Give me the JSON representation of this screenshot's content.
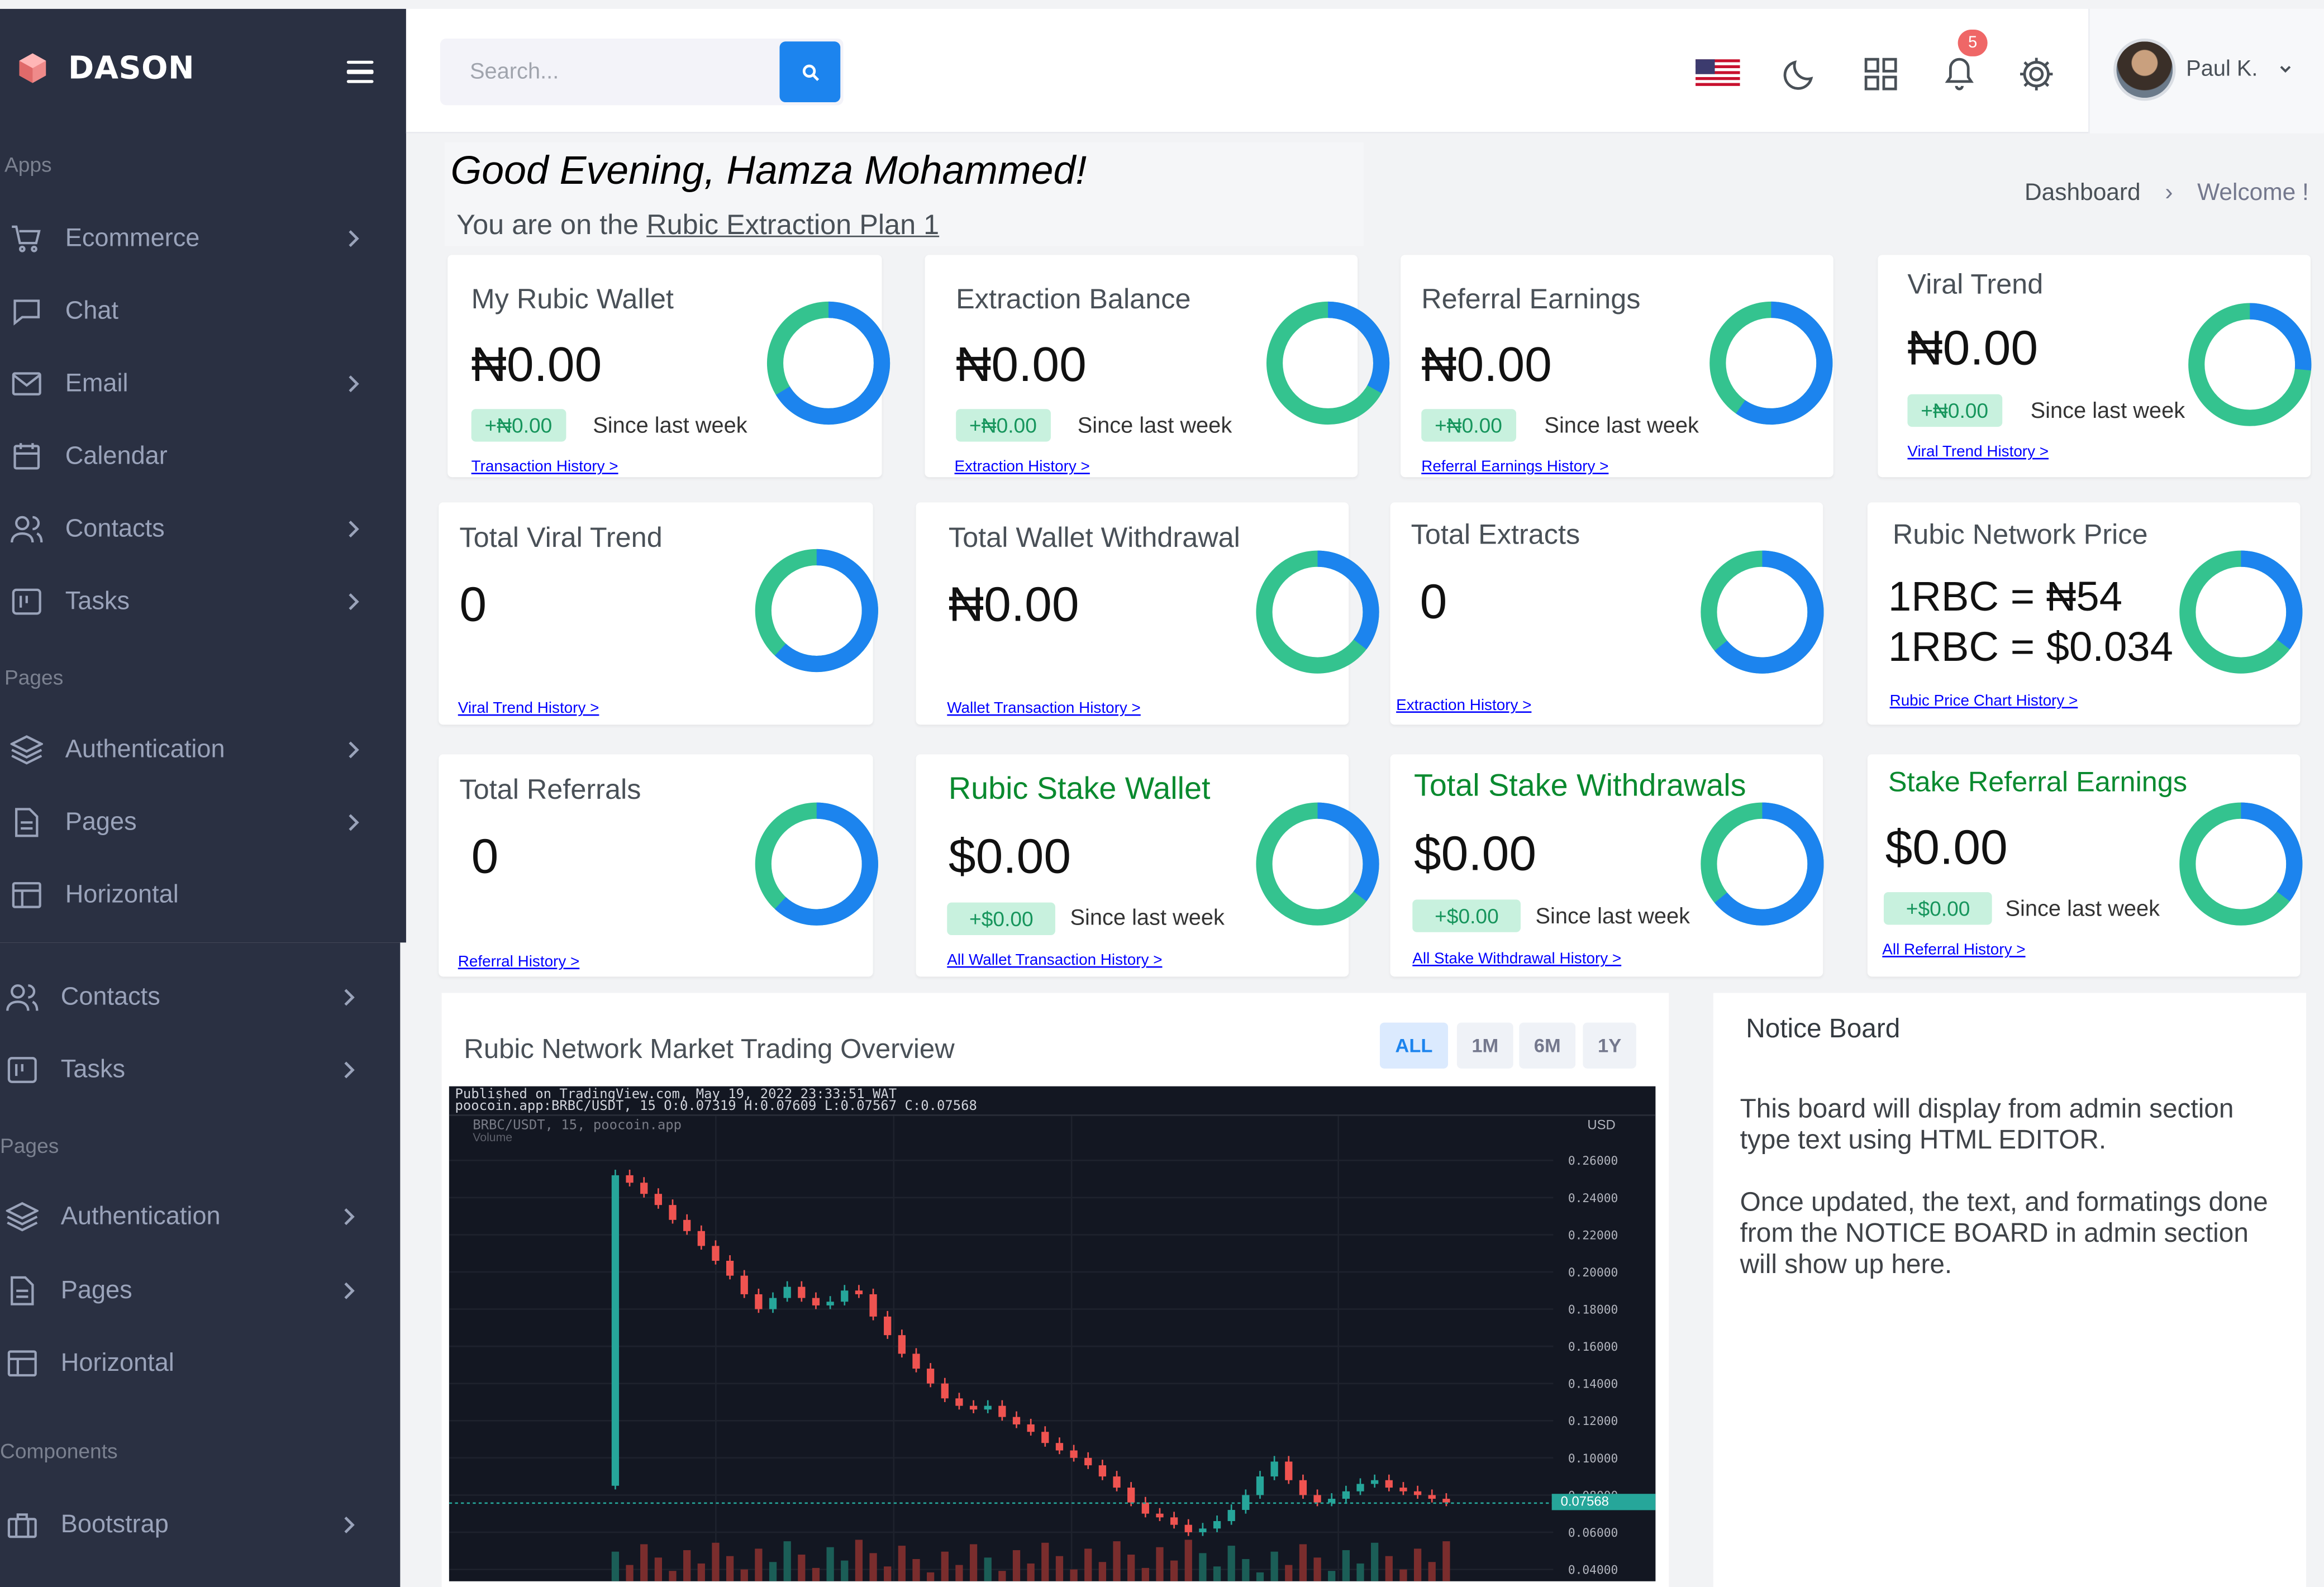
{
  "app": {
    "name": "DASON"
  },
  "sidebar": {
    "sections": {
      "apps": "Apps",
      "pages": "Pages",
      "pages2": "Pages",
      "components": "Components"
    },
    "items": {
      "ecommerce": "Ecommerce",
      "chat": "Chat",
      "email": "Email",
      "calendar": "Calendar",
      "contacts": "Contacts",
      "tasks": "Tasks",
      "authentication": "Authentication",
      "pages": "Pages",
      "horizontal": "Horizontal",
      "contacts2": "Contacts",
      "tasks2": "Tasks",
      "authentication2": "Authentication",
      "pages2": "Pages",
      "horizontal2": "Horizontal",
      "bootstrap": "Bootstrap"
    }
  },
  "topbar": {
    "search_placeholder": "Search...",
    "notification_count": "5",
    "user": "Paul K."
  },
  "welcome": {
    "greeting": "Good Evening, Hamza Mohammed!",
    "plan_prefix": "You are on the ",
    "plan": "Rubic Extraction Plan 1"
  },
  "breadcrumb": {
    "home": "Dashboard",
    "sep": "›",
    "current": "Welcome !"
  },
  "cards": {
    "wallet": {
      "title": "My Rubic Wallet",
      "value": "₦0.00",
      "badge": "+₦0.00",
      "since": "Since last week",
      "link": "Transaction History >"
    },
    "extraction": {
      "title": "Extraction Balance",
      "value": "₦0.00",
      "badge": "+₦0.00",
      "since": "Since last week",
      "link": "Extraction History >"
    },
    "referral": {
      "title": "Referral Earnings",
      "value": "₦0.00",
      "badge": "+₦0.00",
      "since": "Since last week",
      "link": "Referral Earnings History >"
    },
    "viral": {
      "title": "Viral Trend",
      "value": "₦0.00",
      "badge": "+₦0.00",
      "since": "Since last week",
      "link": "Viral Trend History >"
    },
    "total_viral": {
      "title": "Total Viral Trend",
      "value": "0",
      "link": "Viral Trend History >"
    },
    "withdrawal": {
      "title": "Total Wallet Withdrawal",
      "value": "₦0.00",
      "link": "Wallet Transaction History >"
    },
    "extracts": {
      "title": "Total Extracts",
      "value": "0",
      "link": "Extraction History >"
    },
    "price": {
      "title": "Rubic Network Price",
      "line1": "1RBC = ₦54",
      "line2": "1RBC = $0.034",
      "link": "Rubic Price Chart History >"
    },
    "referrals": {
      "title": "Total Referrals",
      "value": "0",
      "link": "Referral History >"
    },
    "stake_wallet": {
      "title": "Rubic Stake Wallet",
      "value": "$0.00",
      "badge": "+$0.00",
      "since": "Since last week",
      "link": "All Wallet Transaction History >"
    },
    "stake_withdrawals": {
      "title": "Total Stake Withdrawals",
      "value": "$0.00",
      "badge": "+$0.00",
      "since": "Since last week",
      "link": "All Stake Withdrawal History >"
    },
    "stake_referral": {
      "title": "Stake Referral Earnings",
      "value": "$0.00",
      "badge": "+$0.00",
      "since": "Since last week",
      "link": "All Referral History >"
    }
  },
  "market": {
    "title": "Rubic Network Market Trading Overview",
    "ranges": [
      "ALL",
      "1M",
      "6M",
      "1Y"
    ],
    "published": "Published on TradingView.com, May 19, 2022 23:33:51 WAT",
    "ohlc": "poocoin.app:BRBC/USDT, 15  O:0.07319 H:0.07609 L:0.07567 C:0.07568",
    "symbol": "BRBC/USDT, 15, poocoin.app",
    "volume_label": "Volume",
    "currency": "USD",
    "last_price": "0.07568"
  },
  "chart_data": {
    "type": "candlestick",
    "title": "BRBC/USDT, 15, poocoin.app",
    "ylabel": "USD",
    "ylim": [
      0.04,
      0.26
    ],
    "yticks": [
      "0.26000",
      "0.24000",
      "0.22000",
      "0.20000",
      "0.18000",
      "0.16000",
      "0.14000",
      "0.12000",
      "0.10000",
      "0.08000",
      "0.06000",
      "0.04000"
    ],
    "close": [
      0.085,
      0.252,
      0.248,
      0.242,
      0.236,
      0.228,
      0.222,
      0.214,
      0.206,
      0.198,
      0.188,
      0.18,
      0.186,
      0.192,
      0.186,
      0.182,
      0.184,
      0.19,
      0.188,
      0.176,
      0.166,
      0.156,
      0.148,
      0.14,
      0.132,
      0.128,
      0.126,
      0.128,
      0.122,
      0.118,
      0.114,
      0.108,
      0.104,
      0.1,
      0.096,
      0.09,
      0.084,
      0.076,
      0.07,
      0.068,
      0.064,
      0.06,
      0.062,
      0.066,
      0.072,
      0.08,
      0.09,
      0.098,
      0.088,
      0.08,
      0.076,
      0.078,
      0.082,
      0.086,
      0.088,
      0.084,
      0.082,
      0.08,
      0.078,
      0.076
    ]
  },
  "notice": {
    "title": "Notice Board",
    "p1a": "This board will display from admin section",
    "p1b": "type text using HTML EDITOR.",
    "p2a": "Once updated, the text, and formatings done",
    "p2b": "from the NOTICE BOARD in admin section",
    "p2c": "will show up here."
  },
  "colors": {
    "sidebar": "#2a3042",
    "primary": "#1c84ee",
    "success": "#34c38f",
    "green_title": "#0a8a2f"
  }
}
